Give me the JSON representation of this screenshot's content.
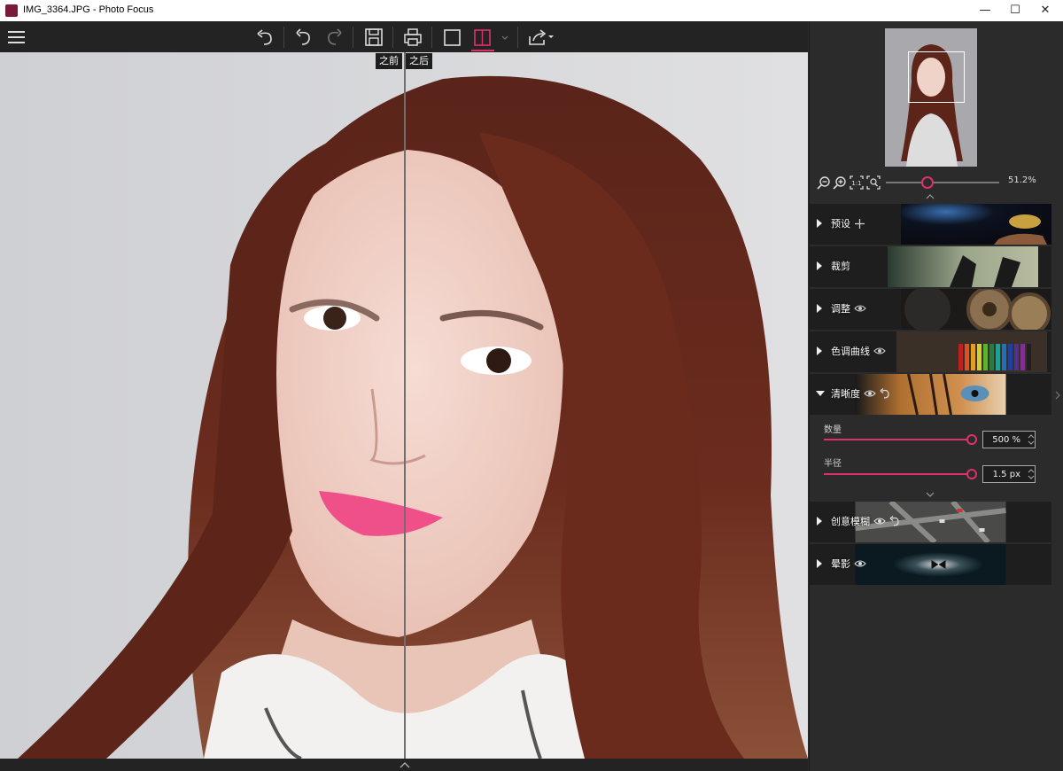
{
  "window": {
    "title": "IMG_3364.JPG - Photo Focus",
    "minimize": "—",
    "maximize": "☐",
    "close": "✕"
  },
  "canvas": {
    "before_label": "之前",
    "after_label": "之后"
  },
  "navigator": {
    "zoom_value": "51.2%"
  },
  "sections": [
    {
      "label": "预设",
      "expanded": false
    },
    {
      "label": "裁剪",
      "expanded": false
    },
    {
      "label": "调整",
      "expanded": false
    },
    {
      "label": "色调曲线",
      "expanded": false
    },
    {
      "label": "清晰度",
      "expanded": true
    },
    {
      "label": "创意模糊",
      "expanded": false
    },
    {
      "label": "晕影",
      "expanded": false
    }
  ],
  "sharpness": {
    "amount_label": "数量",
    "amount_value": "500 %",
    "amount_fraction": 1.0,
    "radius_label": "半径",
    "radius_value": "1.5 px",
    "radius_fraction": 1.0
  },
  "colors": {
    "accent": "#e0306a",
    "panel": "#2b2b2b",
    "toolbar": "#232323"
  }
}
